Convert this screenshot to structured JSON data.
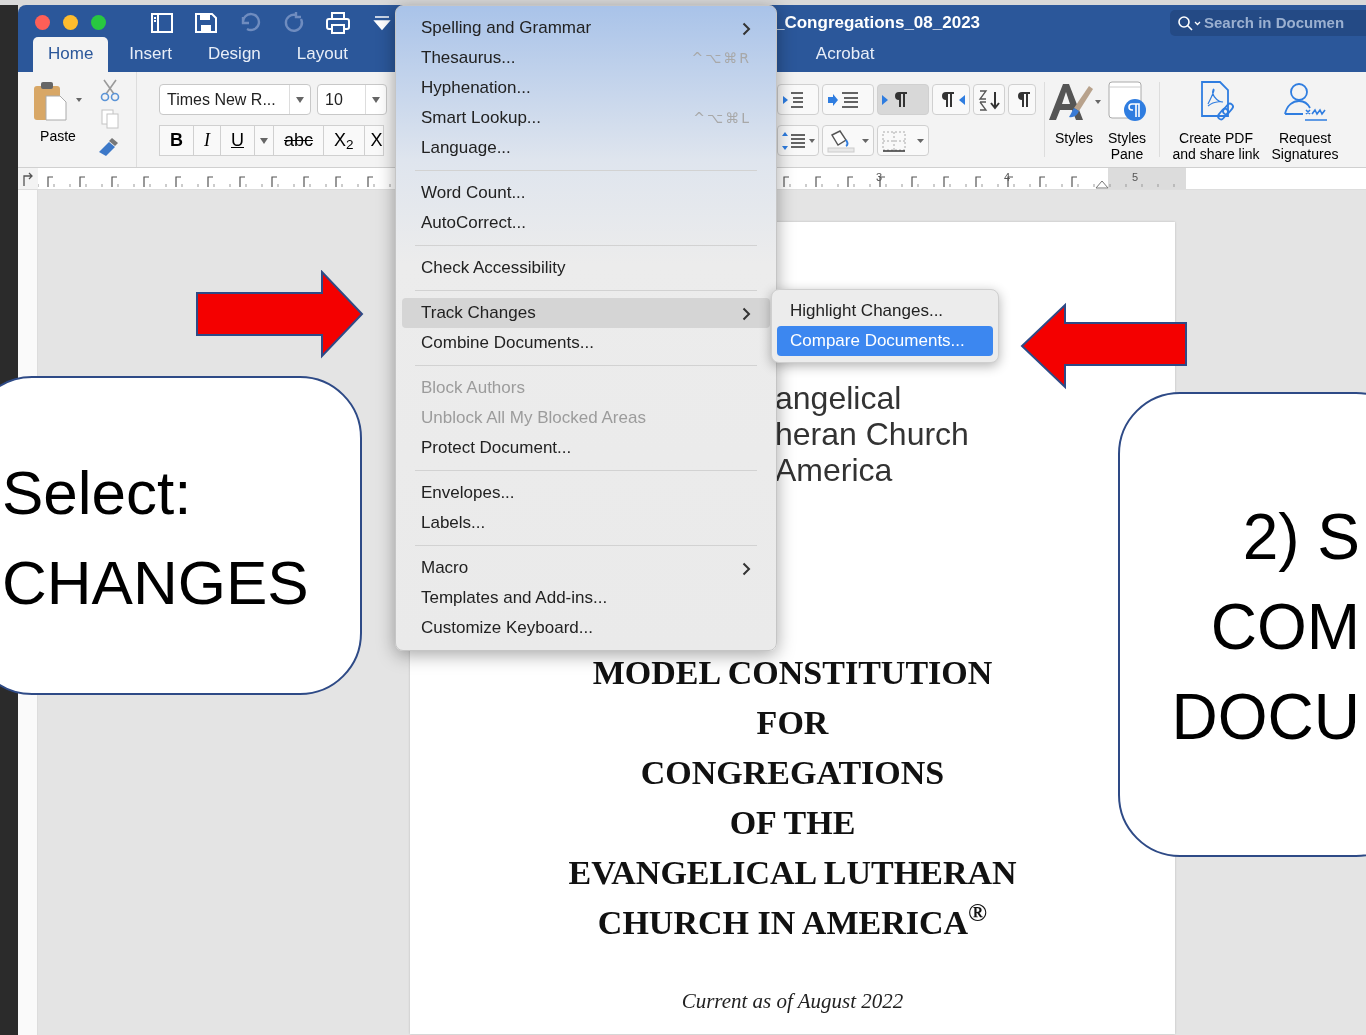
{
  "window": {
    "title": "_Congregations_08_2023",
    "search": {
      "placeholder": "Search in Documen"
    }
  },
  "quick_access": [
    {
      "kind": "sidebar",
      "disabled": false
    },
    {
      "kind": "save",
      "disabled": false
    },
    {
      "kind": "undo",
      "disabled": true
    },
    {
      "kind": "redo",
      "disabled": true
    },
    {
      "kind": "print",
      "disabled": false
    },
    {
      "kind": "customize",
      "disabled": false
    }
  ],
  "tabs": [
    {
      "label": "Home",
      "selected": true
    },
    {
      "label": "Insert",
      "selected": false
    },
    {
      "label": "Design",
      "selected": false
    },
    {
      "label": "Layout",
      "selected": false
    },
    {
      "label": "Acrobat",
      "selected": false
    }
  ],
  "ribbon": {
    "paste": {
      "label": "Paste"
    },
    "font": {
      "name": "Times New R...",
      "size": "10"
    },
    "format_buttons": [
      {
        "kind": "bold",
        "label": "B",
        "dropdown": false
      },
      {
        "kind": "italic",
        "label": "I",
        "dropdown": false
      },
      {
        "kind": "underline",
        "label": "U",
        "dropdown": true
      },
      {
        "kind": "strikethrough",
        "label": "abc",
        "dropdown": false
      },
      {
        "kind": "subscript",
        "label": "X$_{2}$",
        "dropdown": false
      },
      {
        "kind": "superscript",
        "label": "X",
        "dropdown": false
      }
    ],
    "paragraph_tools": [
      {
        "kind": "indent-decrease",
        "pressed": false
      },
      {
        "kind": "indent-increase",
        "pressed": false
      },
      {
        "kind": "ltr",
        "pressed": true
      },
      {
        "kind": "rtl",
        "pressed": false
      },
      {
        "kind": "sort",
        "pressed": false
      },
      {
        "kind": "show-marks",
        "pressed": false
      },
      {
        "kind": "line-spacing",
        "pressed": false
      },
      {
        "kind": "shading",
        "pressed": false
      },
      {
        "kind": "borders",
        "pressed": false
      }
    ],
    "large_buttons": [
      {
        "kind": "styles",
        "label": "Styles"
      },
      {
        "kind": "styles-pane",
        "label": "Styles Pane"
      },
      {
        "kind": "pdf",
        "label": "Create PDF and share link"
      },
      {
        "kind": "signature",
        "label": "Request Signatures"
      }
    ]
  },
  "ruler": {
    "numbers": [
      "3",
      "4",
      "5"
    ]
  },
  "tools_menu": {
    "items": [
      {
        "kind": "item",
        "label": "Spelling and Grammar",
        "submenu": true,
        "disabled": false,
        "selected": false
      },
      {
        "kind": "item",
        "label": "Thesaurus...",
        "shortcut": "^⌥⌘R",
        "disabled": false,
        "selected": false
      },
      {
        "kind": "item",
        "label": "Hyphenation...",
        "disabled": false,
        "selected": false
      },
      {
        "kind": "item",
        "label": "Smart Lookup...",
        "shortcut": "^⌥⌘L",
        "disabled": false,
        "selected": false
      },
      {
        "kind": "item",
        "label": "Language...",
        "disabled": false,
        "selected": false
      },
      {
        "kind": "separator"
      },
      {
        "kind": "item",
        "label": "Word Count...",
        "disabled": false,
        "selected": false
      },
      {
        "kind": "item",
        "label": "AutoCorrect...",
        "disabled": false,
        "selected": false
      },
      {
        "kind": "separator"
      },
      {
        "kind": "item",
        "label": "Check Accessibility",
        "disabled": false,
        "selected": false
      },
      {
        "kind": "separator"
      },
      {
        "kind": "item",
        "label": "Track Changes",
        "submenu": true,
        "disabled": false,
        "selected": true
      },
      {
        "kind": "item",
        "label": "Combine Documents...",
        "disabled": false,
        "selected": false
      },
      {
        "kind": "separator"
      },
      {
        "kind": "item",
        "label": "Block Authors",
        "disabled": true,
        "selected": false
      },
      {
        "kind": "item",
        "label": "Unblock All My Blocked Areas",
        "disabled": true,
        "selected": false
      },
      {
        "kind": "item",
        "label": "Protect Document...",
        "disabled": false,
        "selected": false
      },
      {
        "kind": "separator"
      },
      {
        "kind": "item",
        "label": "Envelopes...",
        "disabled": false,
        "selected": false
      },
      {
        "kind": "item",
        "label": "Labels...",
        "disabled": false,
        "selected": false
      },
      {
        "kind": "separator"
      },
      {
        "kind": "item",
        "label": "Macro",
        "submenu": true,
        "disabled": false,
        "selected": false
      },
      {
        "kind": "item",
        "label": "Templates and Add-ins...",
        "disabled": false,
        "selected": false
      },
      {
        "kind": "item",
        "label": "Customize Keyboard...",
        "disabled": false,
        "selected": false
      }
    ]
  },
  "track_changes_submenu": {
    "items": [
      {
        "label": "Highlight Changes...",
        "selected": false
      },
      {
        "label": "Compare Documents...",
        "selected": true
      }
    ]
  },
  "document": {
    "logo_lines": [
      "angelical",
      "heran Church",
      "America"
    ],
    "title_lines": [
      "MODEL CONSTITUTION",
      "FOR",
      "CONGREGATIONS",
      "OF THE",
      "EVANGELICAL LUTHERAN",
      "CHURCH IN AMERICA$^{®}$"
    ],
    "subtitle": "Current as of August 2022"
  },
  "callouts": [
    {
      "lines": [
        "Select:",
        "CHANGES"
      ]
    },
    {
      "lines": [
        "2) S",
        "COM",
        "DOCU"
      ]
    }
  ]
}
